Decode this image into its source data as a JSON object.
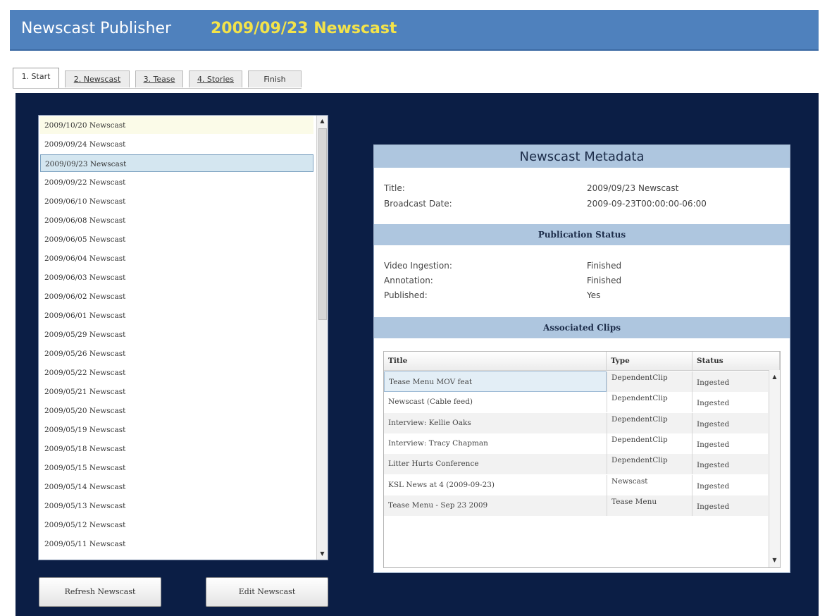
{
  "header": {
    "app_title": "Newscast Publisher",
    "current_newscast": "2009/09/23 Newscast"
  },
  "tabs": [
    {
      "label": "1. Start",
      "active": true
    },
    {
      "label": "2. Newscast",
      "active": false
    },
    {
      "label": "3. Tease",
      "active": false
    },
    {
      "label": "4. Stories",
      "active": false
    },
    {
      "label": "Finish",
      "active": false
    }
  ],
  "newscast_list": {
    "selected_index": 2,
    "items": [
      "2009/10/20 Newscast",
      "2009/09/24 Newscast",
      "2009/09/23 Newscast",
      "2009/09/22 Newscast",
      "2009/06/10 Newscast",
      "2009/06/08 Newscast",
      "2009/06/05 Newscast",
      "2009/06/04 Newscast",
      "2009/06/03 Newscast",
      "2009/06/02 Newscast",
      "2009/06/01 Newscast",
      "2009/05/29 Newscast",
      "2009/05/26 Newscast",
      "2009/05/22 Newscast",
      "2009/05/21 Newscast",
      "2009/05/20 Newscast",
      "2009/05/19 Newscast",
      "2009/05/18 Newscast",
      "2009/05/15 Newscast",
      "2009/05/14 Newscast",
      "2009/05/13 Newscast",
      "2009/05/12 Newscast",
      "2009/05/11 Newscast"
    ]
  },
  "buttons": {
    "refresh": "Refresh Newscast",
    "edit": "Edit Newscast"
  },
  "metadata": {
    "header": "Newscast Metadata",
    "title_label": "Title:",
    "title_value": "2009/09/23 Newscast",
    "date_label": "Broadcast Date:",
    "date_value": "2009-09-23T00:00:00-06:00",
    "publication_header": "Publication Status",
    "video_label": "Video Ingestion:",
    "video_value": "Finished",
    "annotation_label": "Annotation:",
    "annotation_value": "Finished",
    "published_label": "Published:",
    "published_value": "Yes",
    "clips_header": "Associated Clips"
  },
  "clips_table": {
    "columns": [
      "Title",
      "Type",
      "Status"
    ],
    "rows": [
      {
        "title": "Tease Menu MOV feat",
        "type": "DependentClip",
        "status": "Ingested"
      },
      {
        "title": "Newscast (Cable feed)",
        "type": "DependentClip",
        "status": "Ingested"
      },
      {
        "title": "Interview: Kellie Oaks",
        "type": "DependentClip",
        "status": "Ingested"
      },
      {
        "title": "Interview: Tracy Chapman",
        "type": "DependentClip",
        "status": "Ingested"
      },
      {
        "title": "Litter Hurts Conference",
        "type": "DependentClip",
        "status": "Ingested"
      },
      {
        "title": "KSL News at 4 (2009-09-23)",
        "type": "Newscast",
        "status": "Ingested"
      },
      {
        "title": "Tease Menu - Sep 23 2009",
        "type": "Tease Menu",
        "status": "Ingested"
      }
    ]
  },
  "colors": {
    "title_bar": "#4f81bd",
    "newscast_highlight": "#f3e34a",
    "main_background": "#0b1e45",
    "section_header": "#aec6df"
  },
  "icons": {
    "scroll_up": "▲",
    "scroll_down": "▼"
  }
}
